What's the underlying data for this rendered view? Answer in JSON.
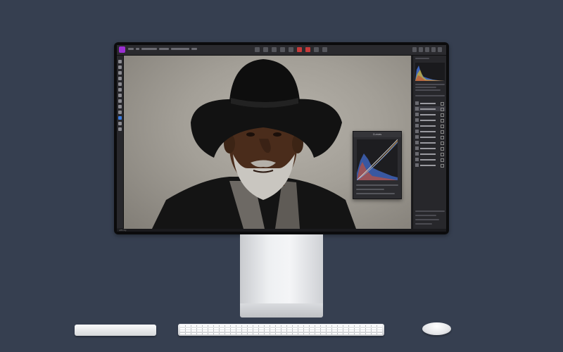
{
  "app": {
    "brand_color": "#9b2fd2",
    "status_label": "Affinity"
  },
  "curves_dialog": {
    "title": "Curves"
  },
  "colors": {
    "background": "#363f50",
    "accent_red": "#c43a3a"
  }
}
